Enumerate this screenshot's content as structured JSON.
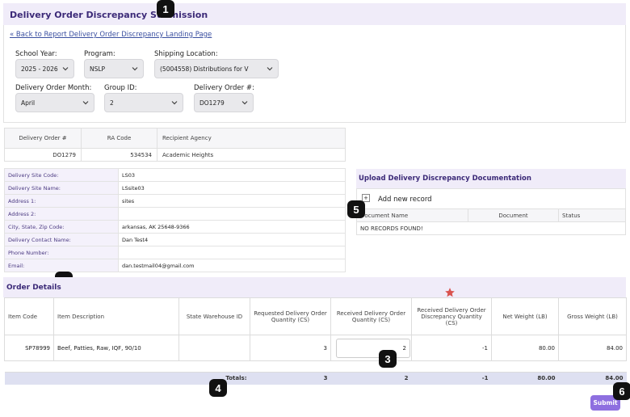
{
  "page_title": "Delivery Order Discrepancy Submission",
  "back_link": "« Back to Report Delivery Order Discrepancy Landing Page",
  "filters": {
    "school_year": {
      "label": "School Year:",
      "value": "2025 - 2026"
    },
    "program": {
      "label": "Program:",
      "value": "NSLP"
    },
    "shipping_location": {
      "label": "Shipping Location:",
      "value": "(5004558) Distributions for V"
    },
    "delivery_order_month": {
      "label": "Delivery Order Month:",
      "value": "April"
    },
    "group_id": {
      "label": "Group ID:",
      "value": "2"
    },
    "delivery_order_no": {
      "label": "Delivery Order #:",
      "value": "DO1279"
    }
  },
  "ra_table": {
    "headers": [
      "Delivery Order #",
      "RA Code",
      "Recipient Agency"
    ],
    "row": [
      "DO1279",
      "534534",
      "Academic Heights"
    ]
  },
  "site_info": [
    {
      "label": "Delivery Site Code:",
      "value": "LS03"
    },
    {
      "label": "Delivery Site Name:",
      "value": "LSsite03"
    },
    {
      "label": "Address 1:",
      "value": "sites"
    },
    {
      "label": "Address 2:",
      "value": ""
    },
    {
      "label": "City, State, Zip Code:",
      "value": "arkansas, AK 25648-9366"
    },
    {
      "label": "Delivery Contact Name:",
      "value": "Dan Test4"
    },
    {
      "label": "Phone Number:",
      "value": ""
    },
    {
      "label": "Email:",
      "value": "dan.testmail04@gmail.com"
    }
  ],
  "upload": {
    "title": "Upload Delivery Discrepancy Documentation",
    "add_label": "Add new record",
    "add_icon": "+",
    "headers": [
      "Document Name",
      "Document",
      "Status"
    ],
    "empty_text": "NO RECORDS FOUND!"
  },
  "order_details": {
    "title": "Order Details",
    "headers": [
      "Item Code",
      "Item Description",
      "State Warehouse ID",
      "Requested Delivery Order Quantity (CS)",
      "Received Delivery Order Quantity (CS)",
      "Received Delivery Order Discrepancy Quantity (CS)",
      "Net Weight (LB)",
      "Gross Weight (LB)"
    ],
    "row": {
      "item_code": "SP78999",
      "description": "Beef, Patties, Raw, IQF, 90/10",
      "warehouse_id": "",
      "requested": "3",
      "received": "2",
      "discrepancy": "-1",
      "net_weight": "80.00",
      "gross_weight": "84.00"
    },
    "totals": {
      "label": "Totals:",
      "requested": "3",
      "received": "2",
      "discrepancy": "-1",
      "net_weight": "80.00",
      "gross_weight": "84.00"
    }
  },
  "submit_label": "Submit",
  "markers": [
    "1",
    "2",
    "3",
    "4",
    "5",
    "6"
  ],
  "colors": {
    "accent": "#8e6fe0",
    "title": "#3c2a78",
    "header_bg": "#f0ecf9",
    "star": "#d9534f"
  }
}
